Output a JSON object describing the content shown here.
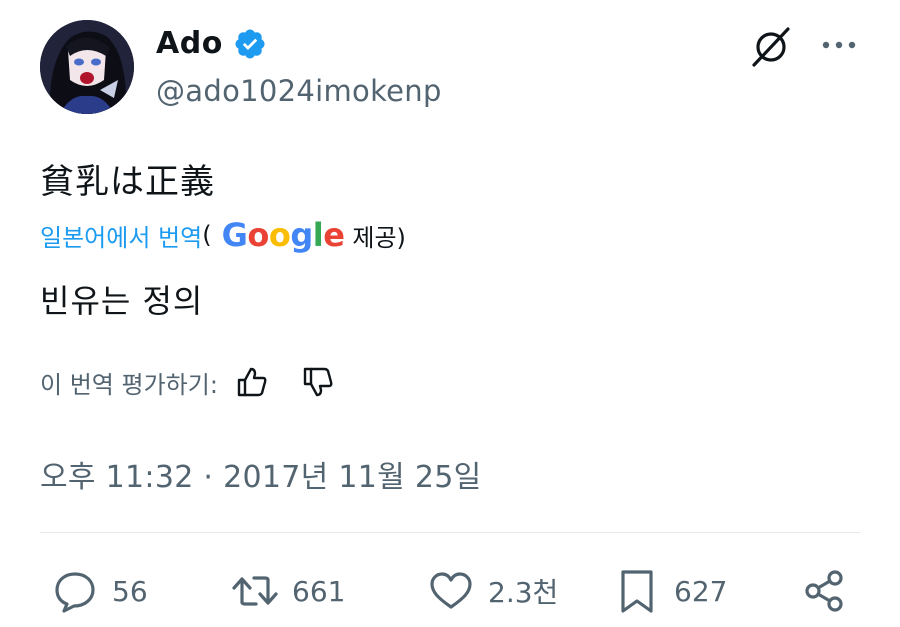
{
  "user": {
    "display_name": "Ado",
    "handle": "@ado1024imokenp",
    "verified": true
  },
  "header": {
    "grok_icon": "grok-icon",
    "more_icon": "more-icon"
  },
  "tweet": {
    "text": "貧乳は正義",
    "translate_label": "일본어에서 번역",
    "paren_open": "(",
    "google": "Google",
    "provided_label": "제공)",
    "translated_text": "빈유는 정의",
    "rate_label": "이 번역 평가하기:",
    "timestamp": "오후 11:32 · 2017년 11월 25일"
  },
  "actions": {
    "replies": "56",
    "reposts": "661",
    "likes": "2.3천",
    "bookmarks": "627"
  },
  "colors": {
    "accent": "#1d9bf0",
    "secondary_text": "#536471",
    "google_blue": "#4285F4",
    "google_red": "#EA4335",
    "google_yellow": "#FBBC05",
    "google_green": "#34A853"
  }
}
